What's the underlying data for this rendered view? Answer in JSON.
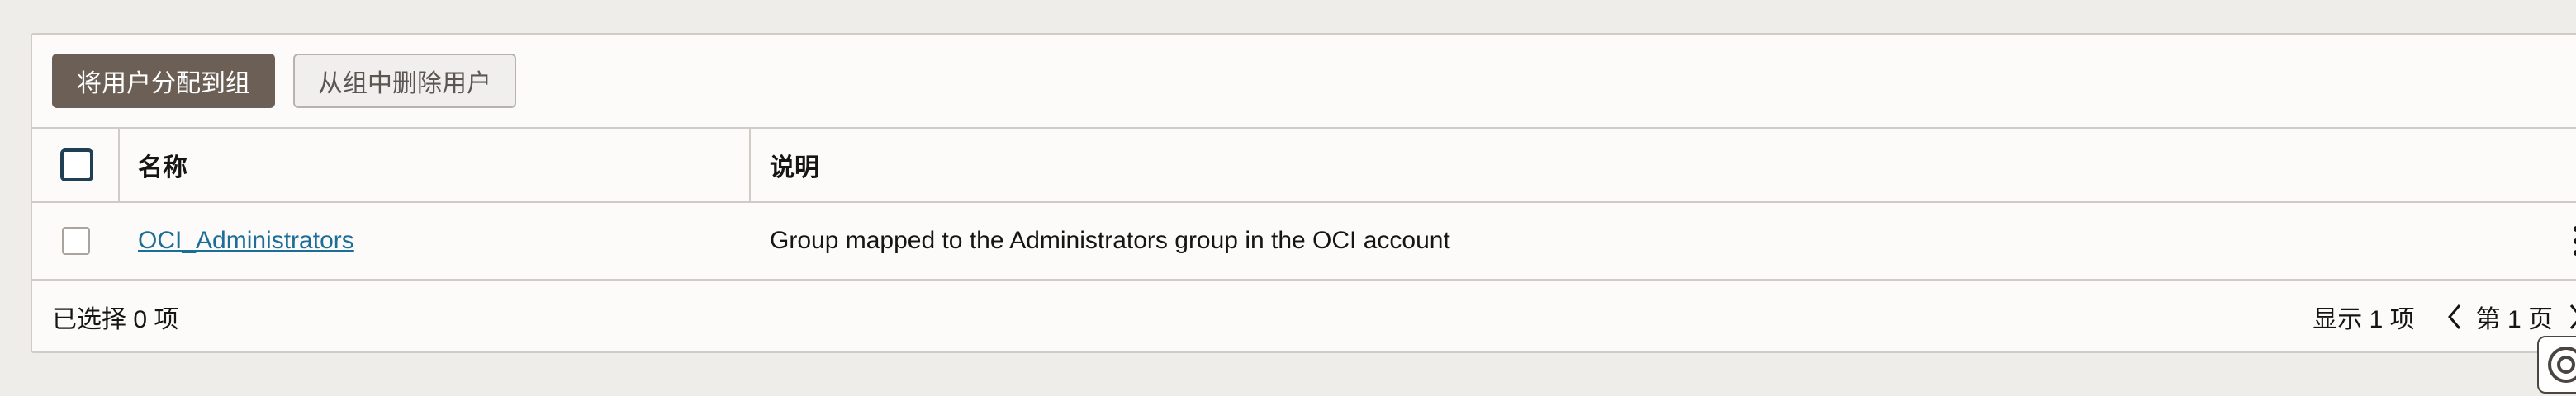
{
  "toolbar": {
    "assign_label": "将用户分配到组",
    "remove_label": "从组中删除用户"
  },
  "table": {
    "columns": {
      "name": "名称",
      "description": "说明"
    },
    "rows": [
      {
        "name": "OCI_Administrators",
        "description": "Group mapped to the Administrators group in the OCI account"
      }
    ]
  },
  "footer": {
    "selected_text": "已选择 0 项",
    "showing_text": "显示 1 项",
    "page_text": "第 1 页"
  },
  "icons": {
    "row_actions": "kebab-menu-icon",
    "prev": "chevron-left-icon",
    "next": "chevron-right-icon",
    "help": "help-icon"
  },
  "colors": {
    "primary_button": "#6b5f56",
    "link": "#1b6e98",
    "checkbox_border": "#1f3f55"
  }
}
